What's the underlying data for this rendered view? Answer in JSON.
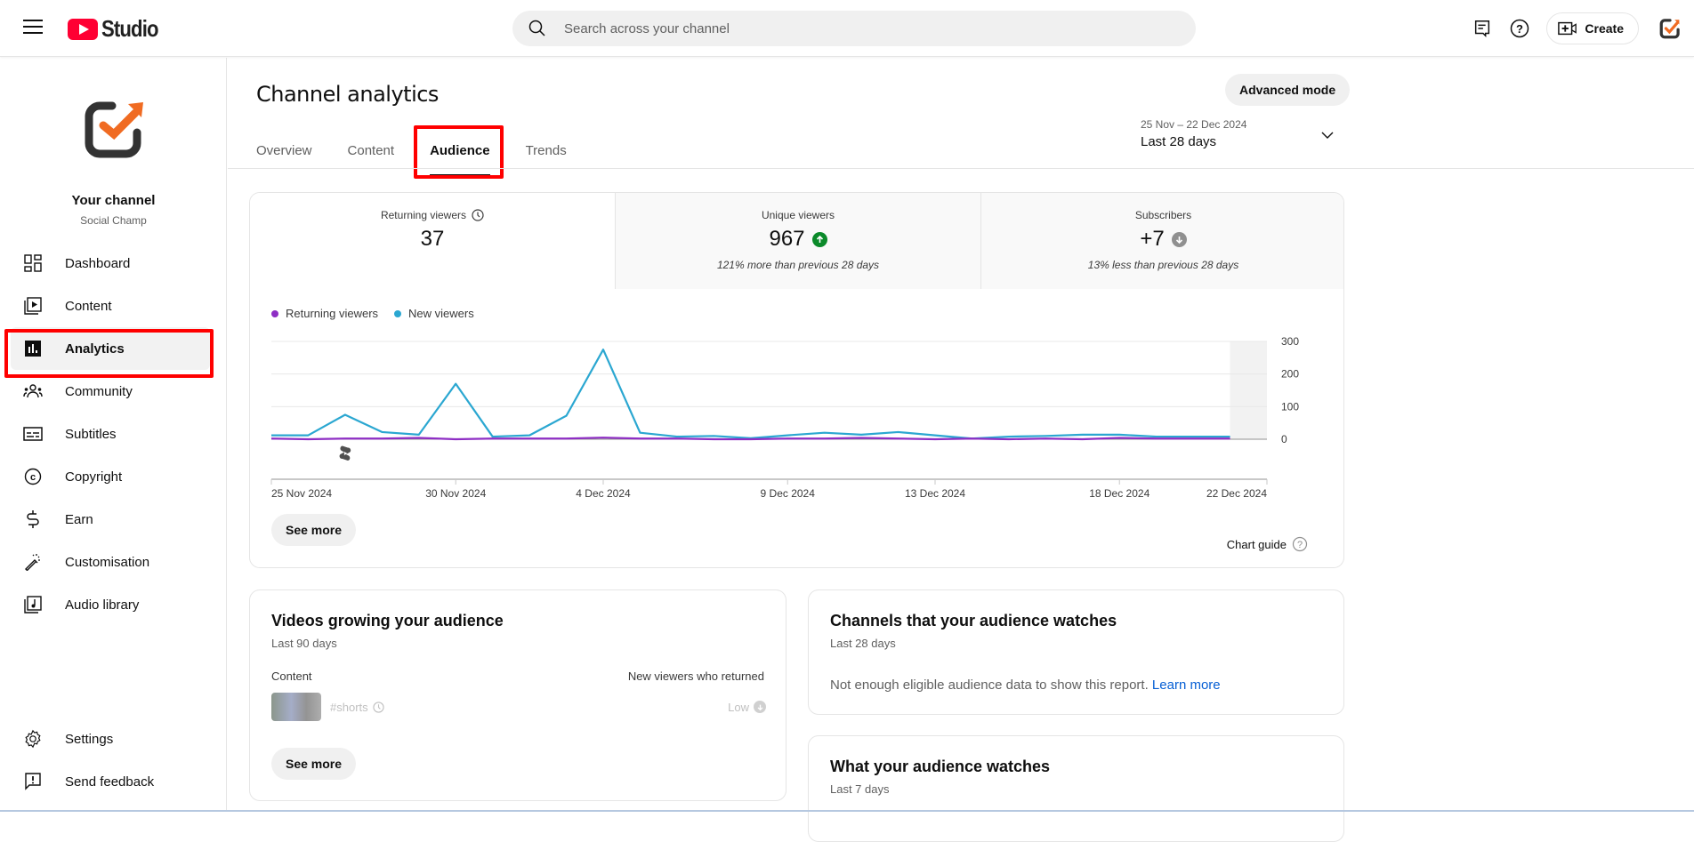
{
  "topbar": {
    "logo_text": "Studio",
    "search_placeholder": "Search across your channel",
    "create_label": "Create"
  },
  "sidebar": {
    "channel_title": "Your channel",
    "channel_name": "Social Champ",
    "items": [
      {
        "label": "Dashboard",
        "icon": "dashboard-icon"
      },
      {
        "label": "Content",
        "icon": "content-icon"
      },
      {
        "label": "Analytics",
        "icon": "analytics-icon",
        "active": true
      },
      {
        "label": "Community",
        "icon": "community-icon"
      },
      {
        "label": "Subtitles",
        "icon": "subtitles-icon"
      },
      {
        "label": "Copyright",
        "icon": "copyright-icon"
      },
      {
        "label": "Earn",
        "icon": "earn-icon"
      },
      {
        "label": "Customisation",
        "icon": "customisation-icon"
      },
      {
        "label": "Audio library",
        "icon": "audio-library-icon"
      }
    ],
    "bottom_items": [
      {
        "label": "Settings",
        "icon": "settings-icon"
      },
      {
        "label": "Send feedback",
        "icon": "feedback-icon"
      }
    ]
  },
  "header": {
    "title": "Channel analytics",
    "advanced_mode_label": "Advanced mode",
    "tabs": [
      {
        "label": "Overview"
      },
      {
        "label": "Content"
      },
      {
        "label": "Audience",
        "active": true
      },
      {
        "label": "Trends"
      }
    ],
    "date_range": "25 Nov – 22 Dec 2024",
    "date_label": "Last 28 days"
  },
  "metrics": [
    {
      "label": "Returning viewers",
      "value": "37",
      "delta": "",
      "trend": "none"
    },
    {
      "label": "Unique viewers",
      "value": "967",
      "delta": "121% more than previous 28 days",
      "trend": "up"
    },
    {
      "label": "Subscribers",
      "value": "+7",
      "delta": "13% less than previous 28 days",
      "trend": "down"
    }
  ],
  "colors": {
    "returning": "#8e2ec4",
    "new": "#2ba7d1",
    "up": "#0b8a2a",
    "down": "#909090",
    "highlight": "#ff0000",
    "link": "#065fd4"
  },
  "chart_data": {
    "type": "line",
    "title": "",
    "xlabel": "",
    "ylabel": "",
    "x_ticks": [
      "25 Nov 2024",
      "30 Nov 2024",
      "4 Dec 2024",
      "9 Dec 2024",
      "13 Dec 2024",
      "18 Dec 2024",
      "22 Dec 2024"
    ],
    "x_tick_day_index": [
      0,
      5,
      9,
      14,
      18,
      23,
      27
    ],
    "y_ticks": [
      "0",
      "100",
      "200",
      "300"
    ],
    "ylim": [
      0,
      300
    ],
    "legend": "top-left",
    "grid": true,
    "x": [
      "25 Nov",
      "26 Nov",
      "27 Nov",
      "28 Nov",
      "29 Nov",
      "30 Nov",
      "1 Dec",
      "2 Dec",
      "3 Dec",
      "4 Dec",
      "5 Dec",
      "6 Dec",
      "7 Dec",
      "8 Dec",
      "9 Dec",
      "10 Dec",
      "11 Dec",
      "12 Dec",
      "13 Dec",
      "14 Dec",
      "15 Dec",
      "16 Dec",
      "17 Dec",
      "18 Dec",
      "19 Dec",
      "20 Dec",
      "21 Dec"
    ],
    "series": [
      {
        "name": "Returning viewers",
        "values": [
          2,
          0,
          2,
          2,
          4,
          0,
          2,
          2,
          2,
          5,
          2,
          2,
          0,
          0,
          2,
          2,
          4,
          2,
          0,
          2,
          0,
          2,
          0,
          4,
          2,
          2,
          2
        ]
      },
      {
        "name": "New viewers",
        "values": [
          12,
          12,
          75,
          22,
          14,
          170,
          8,
          12,
          72,
          275,
          20,
          8,
          10,
          3,
          12,
          20,
          14,
          22,
          12,
          2,
          8,
          10,
          14,
          14,
          8,
          8,
          8
        ]
      }
    ],
    "incomplete_region_start_index": 26,
    "annotation_icon": "shorts-icon",
    "annotation_day_index": 2
  },
  "chart_card": {
    "see_more_label": "See more",
    "chart_guide_label": "Chart guide"
  },
  "videos_growing": {
    "title": "Videos growing your audience",
    "subtitle": "Last 90 days",
    "col_content": "Content",
    "col_metric": "New viewers who returned",
    "rows": [
      {
        "title": "#shorts",
        "value": "Low"
      }
    ],
    "see_more_label": "See more"
  },
  "channels_watch": {
    "title": "Channels that your audience watches",
    "subtitle": "Last 28 days",
    "message": "Not enough eligible audience data to show this report.",
    "link": "Learn more"
  },
  "what_watches": {
    "title": "What your audience watches",
    "subtitle": "Last 7 days"
  }
}
